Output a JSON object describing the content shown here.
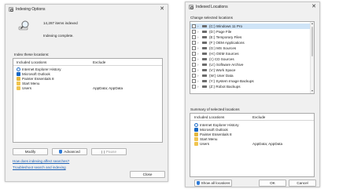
{
  "indexing_options": {
    "title": "Indexing Options",
    "items_indexed": "14,287 items indexed",
    "status": "Indexing complete.",
    "index_these_locations": "Index these locations:",
    "columns": {
      "included": "Included Locations",
      "exclude": "Exclude"
    },
    "locations": [
      {
        "name": "Internet Explorer History",
        "exclude": "",
        "icon": "ie-icon"
      },
      {
        "name": "Microsoft Outlook",
        "exclude": "",
        "icon": "outlook-icon"
      },
      {
        "name": "Painter Essentials 8",
        "exclude": "",
        "icon": "painter-icon"
      },
      {
        "name": "Start Menu",
        "exclude": "",
        "icon": "folder-icon"
      },
      {
        "name": "Users",
        "exclude": "AppData; AppData",
        "icon": "folder-icon"
      }
    ],
    "buttons": {
      "modify": "Modify",
      "advanced": "Advanced",
      "pause": "Pause",
      "close": "Close"
    },
    "links": {
      "how_affects": "How does indexing affect searches?",
      "troubleshoot": "Troubleshoot search and indexing"
    }
  },
  "indexed_locations": {
    "title": "Indexed Locations",
    "change_selected": "Change selected locations",
    "tree_items": [
      {
        "label": "(C:) Windows 11 Pro",
        "selected": true
      },
      {
        "label": "(D:) Page File",
        "selected": false
      },
      {
        "label": "(E:) Temporary Files",
        "selected": false
      },
      {
        "label": "(F:) OEM Applications",
        "selected": false
      },
      {
        "label": "(G:) MS Sources",
        "selected": false
      },
      {
        "label": "(H:) OEM Sources",
        "selected": false
      },
      {
        "label": "(I:) CD Sources",
        "selected": false
      },
      {
        "label": "(U:) Software Archive",
        "selected": false
      },
      {
        "label": "(V:) Work Space",
        "selected": false
      },
      {
        "label": "(W:) User Data",
        "selected": false
      },
      {
        "label": "(Y:) System Image Backups",
        "selected": false
      },
      {
        "label": "(Z:) Robot Backups",
        "selected": false
      }
    ],
    "summary_label": "Summary of selected locations",
    "columns": {
      "included": "Included Locations",
      "exclude": "Exclude"
    },
    "summary": [
      {
        "name": "Internet Explorer History",
        "exclude": "",
        "icon": "ie-icon"
      },
      {
        "name": "Microsoft Outlook",
        "exclude": "",
        "icon": "outlook-icon"
      },
      {
        "name": "Painter Essentials 8",
        "exclude": "",
        "icon": "painter-icon"
      },
      {
        "name": "Start Menu",
        "exclude": "",
        "icon": "folder-icon"
      },
      {
        "name": "Users",
        "exclude": "AppData; AppData",
        "icon": "folder-icon"
      }
    ],
    "buttons": {
      "show_all": "Show all locations",
      "ok": "OK",
      "cancel": "Cancel"
    }
  }
}
